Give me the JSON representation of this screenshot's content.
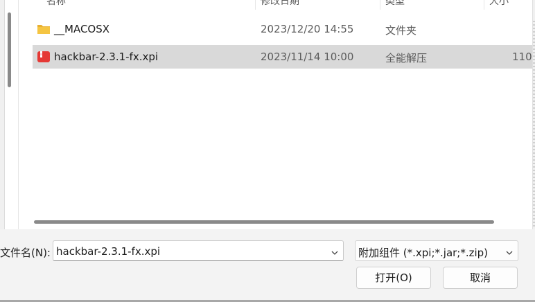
{
  "columns": {
    "name": "名称",
    "modified": "修改日期",
    "type": "类型",
    "size": "大小"
  },
  "files": [
    {
      "name": "__MACOSX",
      "modified": "2023/12/20 14:55",
      "type": "文件夹",
      "size": "",
      "icon": "folder-icon",
      "selected": false
    },
    {
      "name": "hackbar-2.3.1-fx.xpi",
      "modified": "2023/11/14 10:00",
      "type": "全能解压",
      "size": "110",
      "icon": "archive-file-icon",
      "selected": true
    }
  ],
  "filename": {
    "label": "文件名(N):",
    "value": "hackbar-2.3.1-fx.xpi"
  },
  "filter": {
    "selected": "附加组件 (*.xpi;*.jar;*.zip)"
  },
  "buttons": {
    "open": "打开(O)",
    "cancel": "取消"
  },
  "colors": {
    "selected_row": "#d9d9d9",
    "folder": "#f5c542",
    "archive": "#e53935"
  }
}
